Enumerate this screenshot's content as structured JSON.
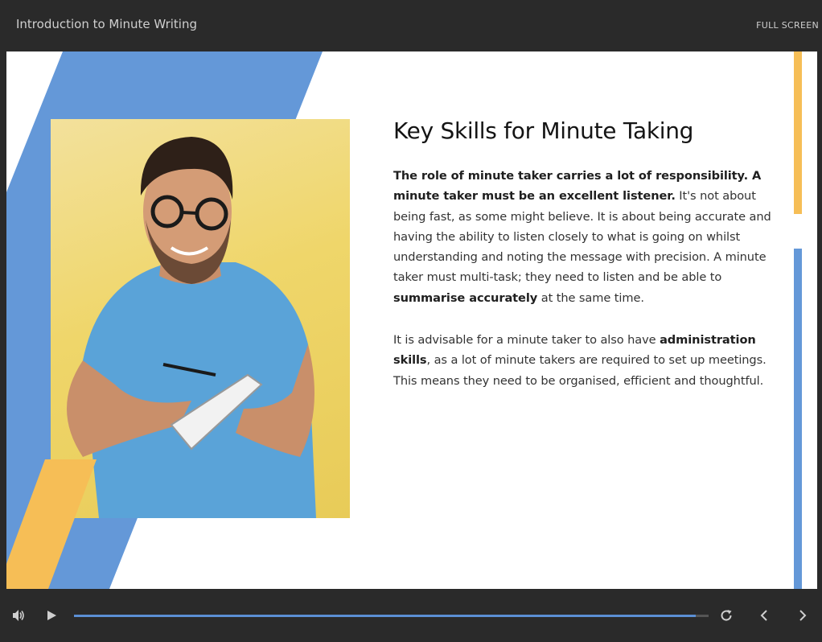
{
  "header": {
    "course_title": "Introduction to Minute Writing",
    "fullscreen_label": "FULL SCREEN"
  },
  "slide": {
    "heading": "Key Skills for Minute Taking",
    "paragraph1": {
      "bold_intro": "The role of minute taker carries a lot of responsibility. A minute taker must be an excellent listener.",
      "text_a": " It's not about being fast, as some might believe. It is about being accurate and having the ability to listen closely to what is going on whilst understanding and noting the message with precision. A minute taker must multi-task; they need to listen and be able to ",
      "bold_term": "summarise accurately",
      "text_b": " at the same time."
    },
    "paragraph2": {
      "text_a": "It is advisable for a minute taker to also have ",
      "bold_term": "administration skills",
      "text_b": ", as a lot of minute takers are required to set up meetings. This means they need to be organised, efficient and thoughtful."
    },
    "colors": {
      "blue": "#6498d8",
      "yellow": "#f6be56",
      "photo_bg": "#efd66a"
    }
  },
  "player": {
    "progress": 0.98,
    "icons": [
      "volume-icon",
      "play-icon",
      "replay-icon",
      "prev-icon",
      "next-icon"
    ],
    "accent_color": "#5b8fd4"
  }
}
